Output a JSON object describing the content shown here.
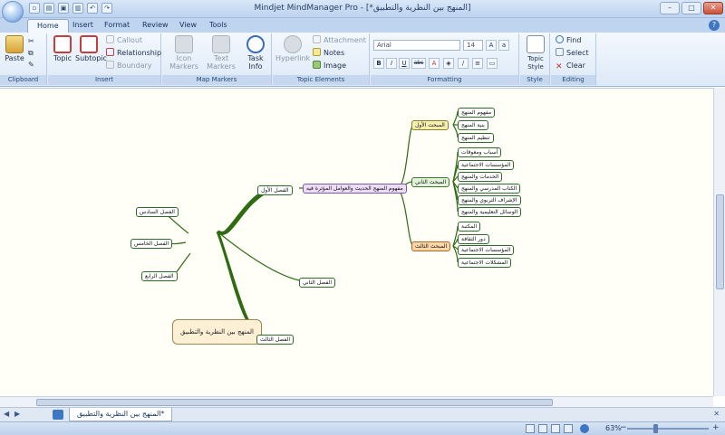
{
  "window": {
    "title": "Mindjet MindManager Pro - [*المنهج بين النظرية والتطبيق]"
  },
  "tabs": [
    "Home",
    "Insert",
    "Format",
    "Review",
    "View",
    "Tools"
  ],
  "ribbon": {
    "clipboard": {
      "label": "Clipboard",
      "paste": "Paste"
    },
    "insert": {
      "label": "Insert",
      "topic": "Topic",
      "subtopic": "Subtopic",
      "callout": "Callout",
      "relationship": "Relationship",
      "boundary": "Boundary"
    },
    "markers": {
      "label": "Map Markers",
      "icon_markers": "Icon Markers",
      "text_markers": "Text Markers",
      "task_info": "Task Info"
    },
    "elements": {
      "label": "Topic Elements",
      "hyperlink": "Hyperlink",
      "attachment": "Attachment",
      "notes": "Notes",
      "image": "Image"
    },
    "formatting": {
      "label": "Formatting",
      "font": "Arial",
      "size": "14",
      "bold": "B",
      "italic": "I",
      "underline": "U",
      "strike": "abc"
    },
    "style": {
      "label": "Style",
      "topic_style": "Topic Style"
    },
    "editing": {
      "label": "Editing",
      "find": "Find",
      "select": "Select",
      "clear": "Clear"
    }
  },
  "map": {
    "central": "المنهج بين النظرية والتطبيق",
    "ch1": "الفصل الأول",
    "ch1_main": "مفهوم المنهج الحديث والعوامل المؤثرة فيه",
    "sec1": "المبحث الأول",
    "sec2": "المبحث الثاني",
    "sec3": "المبحث الثالث",
    "sec1_items": [
      "مفهوم المنهج",
      "بنية المنهج",
      "تنظيم المنهج"
    ],
    "sec2_items": [
      "أسباب ومعوقات",
      "المؤسسات الاجتماعية",
      "الخدمات والمنهج",
      "الكتاب المدرسي والمنهج",
      "الإشراف التربوي والمنهج",
      "الوسائل التعليمية والمنهج"
    ],
    "sec3_items": [
      "المكتبة",
      "دور الثقافة",
      "المؤسسات الاجتماعية",
      "المشكلات الاجتماعية"
    ],
    "ch2": "الفصل الثاني",
    "ch3": "الفصل الثالث",
    "ch4": "الفصل الرابع",
    "ch5": "الفصل الخامس",
    "ch6": "الفصل السادس"
  },
  "doc_tab": "المنهج بين النظرية والتطبيق*",
  "status": {
    "zoom": "63%"
  },
  "colors": {
    "branch": "#2e6b12",
    "accent": "#2a5aa0"
  }
}
